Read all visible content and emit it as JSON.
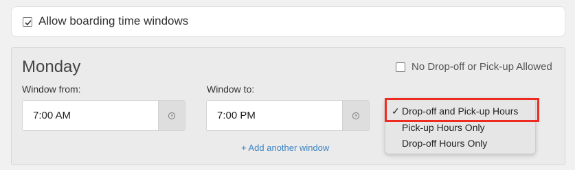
{
  "boarding": {
    "allow_label": "Allow boarding time windows",
    "allow_checked": true
  },
  "day": {
    "title": "Monday",
    "no_dropoff_label": "No Drop-off or Pick-up Allowed",
    "no_dropoff_checked": false,
    "window_from_label": "Window from:",
    "window_from_value": "7:00 AM",
    "window_to_label": "Window to:",
    "window_to_value": "7:00 PM",
    "add_window_label": "+ Add another window"
  },
  "menu": {
    "selected_mark": "✓",
    "options": [
      {
        "label": "Drop-off and Pick-up Hours",
        "selected": true
      },
      {
        "label": "Pick-up Hours Only",
        "selected": false
      },
      {
        "label": "Drop-off Hours Only",
        "selected": false
      }
    ]
  },
  "colors": {
    "link": "#3a83c4",
    "highlight": "#ef2a22"
  },
  "icons": {
    "checkmark": "check-icon",
    "time": "clock-icon"
  }
}
